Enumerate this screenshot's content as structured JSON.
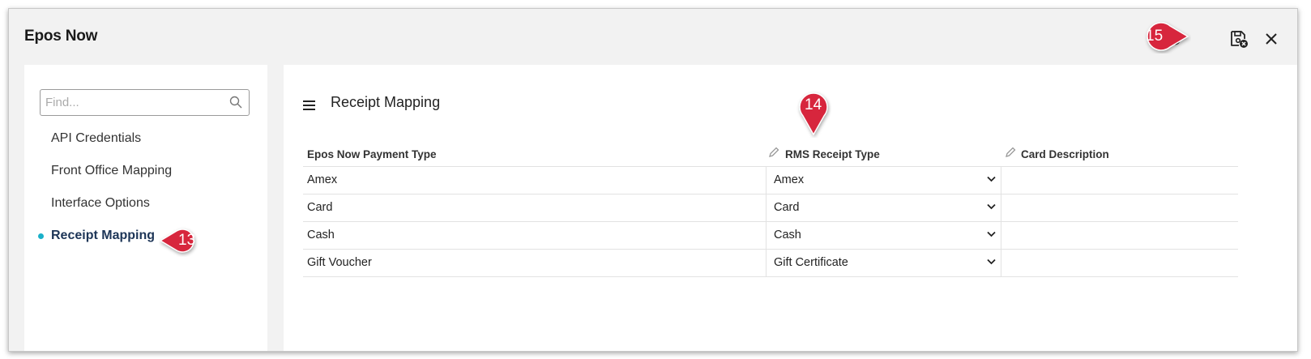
{
  "window": {
    "title": "Epos Now"
  },
  "header_icons": [
    "refresh-icon",
    "save-icon",
    "close-icon"
  ],
  "sidebar": {
    "search_placeholder": "Find...",
    "items": [
      {
        "label": "API Credentials",
        "active": false
      },
      {
        "label": "Front Office Mapping",
        "active": false
      },
      {
        "label": "Interface Options",
        "active": false
      },
      {
        "label": "Receipt Mapping",
        "active": true
      }
    ]
  },
  "main": {
    "title": "Receipt Mapping",
    "columns": [
      "Epos Now Payment Type",
      "RMS Receipt Type",
      "Card Description"
    ],
    "rows": [
      {
        "payment_type": "Amex",
        "receipt_type": "Amex",
        "card_description": ""
      },
      {
        "payment_type": "Card",
        "receipt_type": "Card",
        "card_description": ""
      },
      {
        "payment_type": "Cash",
        "receipt_type": "Cash",
        "card_description": ""
      },
      {
        "payment_type": "Gift Voucher",
        "receipt_type": "Gift Certificate",
        "card_description": ""
      }
    ]
  },
  "callouts": {
    "c13": "13",
    "c14": "14",
    "c15": "15"
  },
  "colors": {
    "accent": "#1ab0c9",
    "callout": "#d7263d",
    "active_text": "#1d3557"
  }
}
